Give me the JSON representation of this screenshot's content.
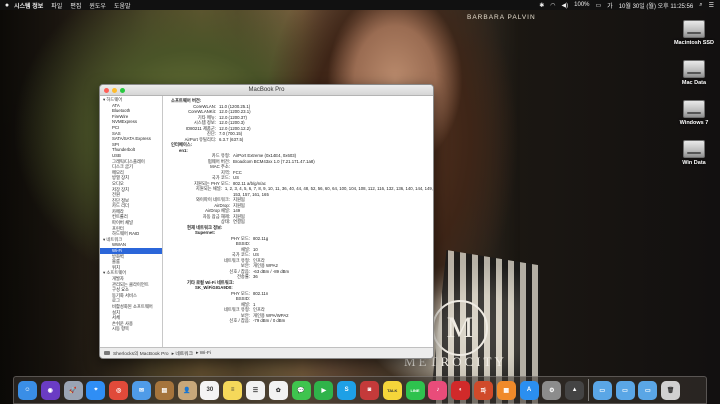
{
  "menubar": {
    "app": "시스템 정보",
    "menus": [
      "파일",
      "편집",
      "윈도우",
      "도움말"
    ],
    "battery": "100%",
    "clock": "10월 30일 (월) 오후 11:25:56"
  },
  "wallpaper": {
    "artist_label": "BARBARA PALVIN",
    "logo_letter": "M",
    "logo_text": "METROCITY"
  },
  "desktop_icons": [
    {
      "label": "Macintosh SSD"
    },
    {
      "label": "Mac Data"
    },
    {
      "label": "Windows 7"
    },
    {
      "label": "Win Data"
    }
  ],
  "window": {
    "title": "MacBook Pro",
    "sidebar": [
      {
        "label": "▾ 하드웨어",
        "group": true
      },
      {
        "label": "ATA"
      },
      {
        "label": "Bluetooth"
      },
      {
        "label": "FireWire"
      },
      {
        "label": "NVMExpress"
      },
      {
        "label": "PCI"
      },
      {
        "label": "SAS"
      },
      {
        "label": "SATA/SATA Express"
      },
      {
        "label": "SPI"
      },
      {
        "label": "Thunderbolt"
      },
      {
        "label": "USB"
      },
      {
        "label": "그래픽/디스플레이"
      },
      {
        "label": "디스크 굽기"
      },
      {
        "label": "메모리"
      },
      {
        "label": "방열 장치"
      },
      {
        "label": "오디오"
      },
      {
        "label": "저장 장치"
      },
      {
        "label": "전원"
      },
      {
        "label": "진단 정보"
      },
      {
        "label": "카드 리더"
      },
      {
        "label": "카메라"
      },
      {
        "label": "컨트롤러"
      },
      {
        "label": "파이버 채널"
      },
      {
        "label": "프린터"
      },
      {
        "label": "하드웨어 RAID"
      },
      {
        "label": "▾ 네트워크",
        "group": true
      },
      {
        "label": "WWAN"
      },
      {
        "label": "Wi-Fi",
        "selected": true
      },
      {
        "label": "방화벽"
      },
      {
        "label": "볼륨"
      },
      {
        "label": "위치"
      },
      {
        "label": "▾ 소프트웨어",
        "group": true
      },
      {
        "label": "개발자"
      },
      {
        "label": "관리되는 클라이언트"
      },
      {
        "label": "구성 요소"
      },
      {
        "label": "동기화 서비스"
      },
      {
        "label": "로그"
      },
      {
        "label": "비활성화된 소프트웨어"
      },
      {
        "label": "설치"
      },
      {
        "label": "서체"
      },
      {
        "label": "손쉬운 사용"
      },
      {
        "label": "시동 항목"
      }
    ],
    "detail": [
      {
        "k": "소프트웨어 버전:",
        "v": "",
        "head": true,
        "indent": 0
      },
      {
        "k": "CoreWLAN:",
        "v": "11.0 (1200.25.1)",
        "indent": 1
      },
      {
        "k": "CoreWLANKit:",
        "v": "12.0 (1200.23.1)",
        "indent": 1
      },
      {
        "k": "기타 메뉴:",
        "v": "12.0 (1200.37)",
        "indent": 1
      },
      {
        "k": "시스템 정보:",
        "v": "12.0 (1200.3)",
        "indent": 1
      },
      {
        "k": "IO80211 제품군:",
        "v": "12.0 (1200.12.2)",
        "indent": 1
      },
      {
        "k": "진단:",
        "v": "7.0 (700.15)",
        "indent": 1
      },
      {
        "k": "AirPort 유틸리티:",
        "v": "6.3.7 (637.5)",
        "indent": 1
      },
      {
        "k": "인터페이스:",
        "v": "",
        "head": true,
        "indent": 0
      },
      {
        "k": "en1:",
        "v": "",
        "head": true,
        "indent": 1
      },
      {
        "k": "카드 유형:",
        "v": "AirPort Extreme  (0x14E4, 0x603)",
        "indent": 2
      },
      {
        "k": "펌웨어 버전:",
        "v": "Broadcom BCM43xx 1.0 (7.21.171.47.1a8)",
        "indent": 2
      },
      {
        "k": "MAC 주소:",
        "v": "",
        "indent": 2
      },
      {
        "k": "지역:",
        "v": "FCC",
        "indent": 2
      },
      {
        "k": "국가 코드:",
        "v": "US",
        "indent": 2
      },
      {
        "k": "지원되는 PHY 모드:",
        "v": "802.11 a/b/g/n/ac",
        "indent": 2
      },
      {
        "k": "지원되는 채널:",
        "v": "1, 2, 3, 4, 5, 6, 7, 8, 9, 10, 11, 36, 40, 44, 48, 52, 56, 60, 64, 100, 104, 108, 112, 116, 132, 136, 140, 144, 149,",
        "indent": 2
      },
      {
        "k": "",
        "v": "153, 157, 161, 165",
        "indent": 2
      },
      {
        "k": "와이파이 네트워크:",
        "v": "지원됨",
        "indent": 2
      },
      {
        "k": "AirDrop:",
        "v": "지원됨",
        "indent": 2
      },
      {
        "k": "AirDrop 채널:",
        "v": "149",
        "indent": 2
      },
      {
        "k": "자동 잠금 해제:",
        "v": "지원됨",
        "indent": 2
      },
      {
        "k": "상태:",
        "v": "연결됨",
        "indent": 2
      },
      {
        "k": "현재 네트워크 정보:",
        "v": "",
        "head": true,
        "indent": 2
      },
      {
        "k": "Supernet:",
        "v": "",
        "head": true,
        "indent": 3
      },
      {
        "k": "PHY 모드:",
        "v": "802.11g",
        "indent": 4
      },
      {
        "k": "BSSID:",
        "v": "",
        "indent": 4
      },
      {
        "k": "채널:",
        "v": "10",
        "indent": 4
      },
      {
        "k": "국가 코드:",
        "v": "US",
        "indent": 4
      },
      {
        "k": "네트워크 유형:",
        "v": "인프라",
        "indent": 4
      },
      {
        "k": "보안:",
        "v": "개인용 WPA2",
        "indent": 4
      },
      {
        "k": "신호 / 잡음:",
        "v": "-63 dBm / -89 dBm",
        "indent": 4
      },
      {
        "k": "전송률:",
        "v": "36",
        "indent": 4
      },
      {
        "k": "기타 로컬 Wi-Fi 네트워크:",
        "v": "",
        "head": true,
        "indent": 2
      },
      {
        "k": "SK_WiFiGIGA9D0:",
        "v": "",
        "head": true,
        "indent": 3
      },
      {
        "k": "PHY 모드:",
        "v": "802.11n",
        "indent": 4
      },
      {
        "k": "BSSID:",
        "v": "",
        "indent": 4
      },
      {
        "k": "채널:",
        "v": "1",
        "indent": 4
      },
      {
        "k": "네트워크 유형:",
        "v": "인프라",
        "indent": 4
      },
      {
        "k": "보안:",
        "v": "개인용 WPA/WPA2",
        "indent": 4
      },
      {
        "k": "신호 / 잡음:",
        "v": "-79 dBm / 0 dBm",
        "indent": 4
      }
    ],
    "pathbar": [
      "Sherlocks의 MacBook Pro",
      "▸ 네트워크",
      "▸ Wi-Fi"
    ]
  },
  "dock": [
    {
      "name": "finder-icon",
      "color": "#3a8ee6",
      "glyph": "☺"
    },
    {
      "name": "siri-icon",
      "color": "#6a3cc4",
      "glyph": "◉"
    },
    {
      "name": "launchpad-icon",
      "color": "#9aa4b4",
      "glyph": "🚀"
    },
    {
      "name": "safari-icon",
      "color": "#2f8ef5",
      "glyph": "⌖"
    },
    {
      "name": "chrome-icon",
      "color": "#e04a3a",
      "glyph": "◎"
    },
    {
      "name": "mail-icon",
      "color": "#4f9be8",
      "glyph": "✉"
    },
    {
      "name": "notebook-icon",
      "color": "#a5743c",
      "glyph": "▤"
    },
    {
      "name": "contacts-icon",
      "color": "#c7a77a",
      "glyph": "👤"
    },
    {
      "name": "calendar-icon",
      "color": "#f4f4f4",
      "glyph": "30"
    },
    {
      "name": "notes-icon",
      "color": "#f5d85a",
      "glyph": "≡"
    },
    {
      "name": "reminders-icon",
      "color": "#f2f2f2",
      "glyph": "☰"
    },
    {
      "name": "photos-icon",
      "color": "#f2f2f2",
      "glyph": "✿"
    },
    {
      "name": "messages-icon",
      "color": "#3fc44e",
      "glyph": "💬"
    },
    {
      "name": "facetime-icon",
      "color": "#2fb34a",
      "glyph": "▶"
    },
    {
      "name": "skype-icon",
      "color": "#1ea0e6",
      "glyph": "S"
    },
    {
      "name": "photo-booth-icon",
      "color": "#c43a3a",
      "glyph": "◙"
    },
    {
      "name": "kakaotalk-icon",
      "color": "#f6d63a",
      "glyph": "TALK"
    },
    {
      "name": "line-icon",
      "color": "#2ec24e",
      "glyph": "LINE"
    },
    {
      "name": "itunes-icon",
      "color": "#e94c7a",
      "glyph": "♪"
    },
    {
      "name": "podcast-icon",
      "color": "#d12a2a",
      "glyph": "◐"
    },
    {
      "name": "korean-app-icon",
      "color": "#d04a2a",
      "glyph": "파"
    },
    {
      "name": "ibooks-icon",
      "color": "#f08a2a",
      "glyph": "▦"
    },
    {
      "name": "app-store-icon",
      "color": "#2b8ff0",
      "glyph": "A"
    },
    {
      "name": "system-preferences-icon",
      "color": "#8c8c8c",
      "glyph": "⚙"
    },
    {
      "name": "terminal-icon",
      "color": "#444444",
      "glyph": "▲"
    },
    {
      "name": "separator",
      "color": "",
      "glyph": ""
    },
    {
      "name": "applications-folder-icon",
      "color": "#5aa6e6",
      "glyph": "▭"
    },
    {
      "name": "documents-folder-icon",
      "color": "#5aa6e6",
      "glyph": "▭"
    },
    {
      "name": "downloads-folder-icon",
      "color": "#5aa6e6",
      "glyph": "▭"
    },
    {
      "name": "trash-icon",
      "color": "#d0d0d0",
      "glyph": "🗑"
    }
  ],
  "colors": {
    "selection": "#2b66d9",
    "close": "#ff5f57",
    "minimize": "#febc2e",
    "zoom": "#28c840"
  }
}
